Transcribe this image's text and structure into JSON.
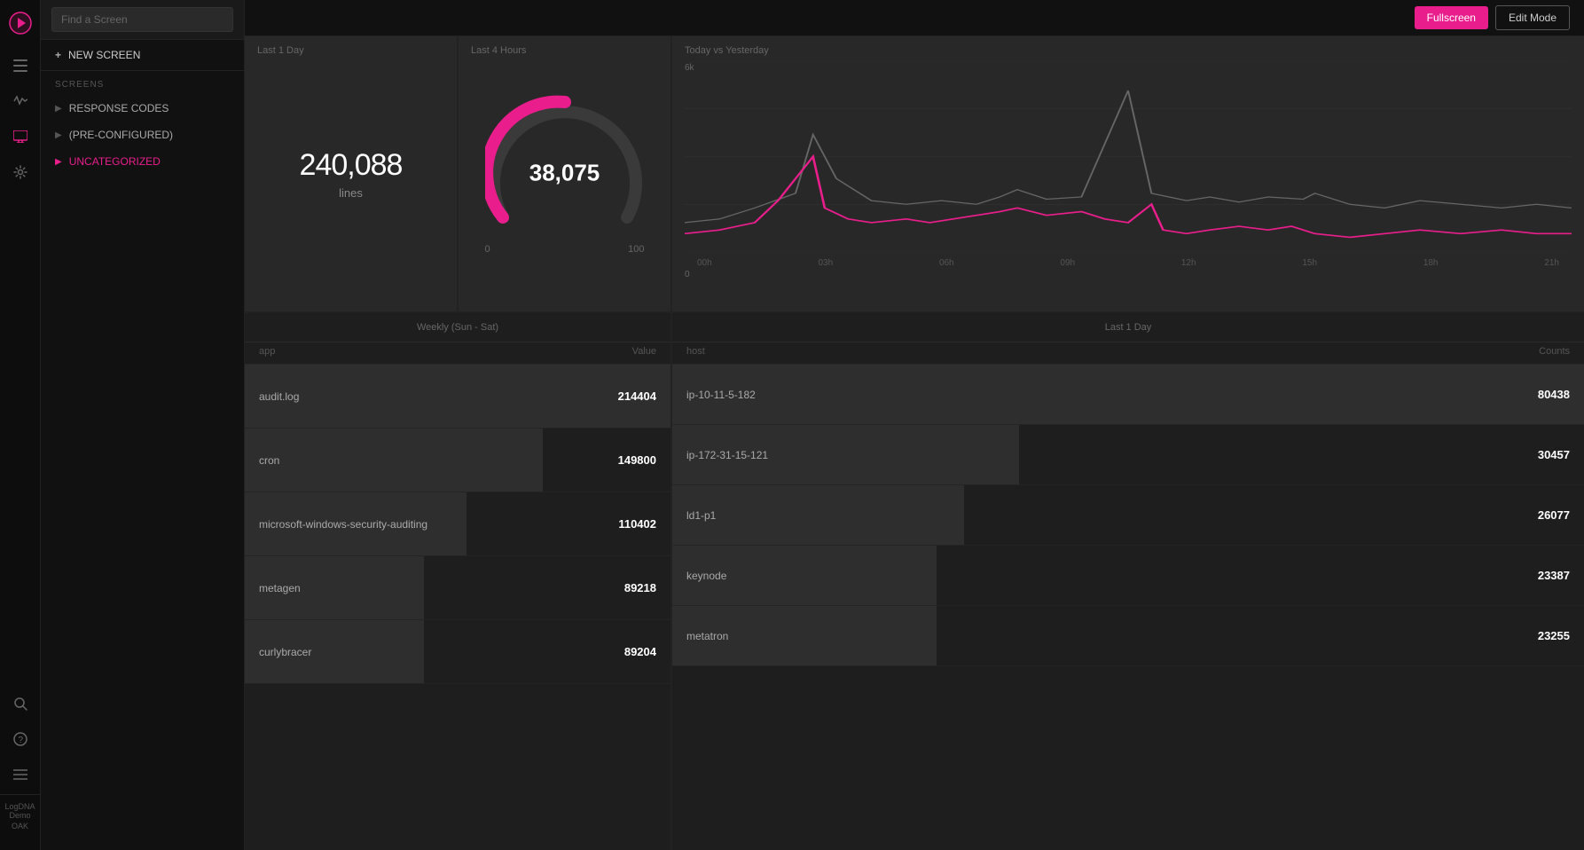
{
  "topbar": {
    "fullscreen_label": "Fullscreen",
    "editmode_label": "Edit Mode"
  },
  "sidebar": {
    "search_placeholder": "Find a Screen",
    "new_screen_label": "NEW SCREEN",
    "screens_label": "SCREENS",
    "items": [
      {
        "label": "RESPONSE CODES",
        "active": false
      },
      {
        "label": "(PRE-CONFIGURED)",
        "active": false
      },
      {
        "label": "UNCATEGORIZED",
        "active": true
      }
    ]
  },
  "user": {
    "name": "LogDNA Demo",
    "sub": "OAK"
  },
  "panels": {
    "stat": {
      "label": "Last 1 Day",
      "value": "240,088",
      "unit": "lines"
    },
    "gauge": {
      "label": "Last 4 Hours",
      "value": "38,075",
      "min": "0",
      "max": "100"
    },
    "chart": {
      "label": "Today vs Yesterday",
      "y_max": "6k",
      "y_min": "0",
      "x_labels": [
        "00h",
        "03h",
        "06h",
        "09h",
        "12h",
        "15h",
        "18h",
        "21h"
      ]
    },
    "weekly": {
      "title": "Weekly (Sun - Sat)",
      "col_app": "app",
      "col_value": "Value",
      "rows": [
        {
          "name": "audit.log",
          "value": "214404",
          "bar_pct": 100
        },
        {
          "name": "cron",
          "value": "149800",
          "bar_pct": 70
        },
        {
          "name": "microsoft-windows-security-auditing",
          "value": "110402",
          "bar_pct": 52
        },
        {
          "name": "metagen",
          "value": "89218",
          "bar_pct": 42
        },
        {
          "name": "curlybracer",
          "value": "89204",
          "bar_pct": 42
        }
      ]
    },
    "hosts": {
      "title": "Last 1 Day",
      "col_host": "host",
      "col_counts": "Counts",
      "rows": [
        {
          "name": "ip-10-11-5-182",
          "value": "80438",
          "bar_pct": 100
        },
        {
          "name": "ip-172-31-15-121",
          "value": "30457",
          "bar_pct": 38
        },
        {
          "name": "ld1-p1",
          "value": "26077",
          "bar_pct": 32
        },
        {
          "name": "keynode",
          "value": "23387",
          "bar_pct": 29
        },
        {
          "name": "metatron",
          "value": "23255",
          "bar_pct": 29
        }
      ]
    }
  }
}
